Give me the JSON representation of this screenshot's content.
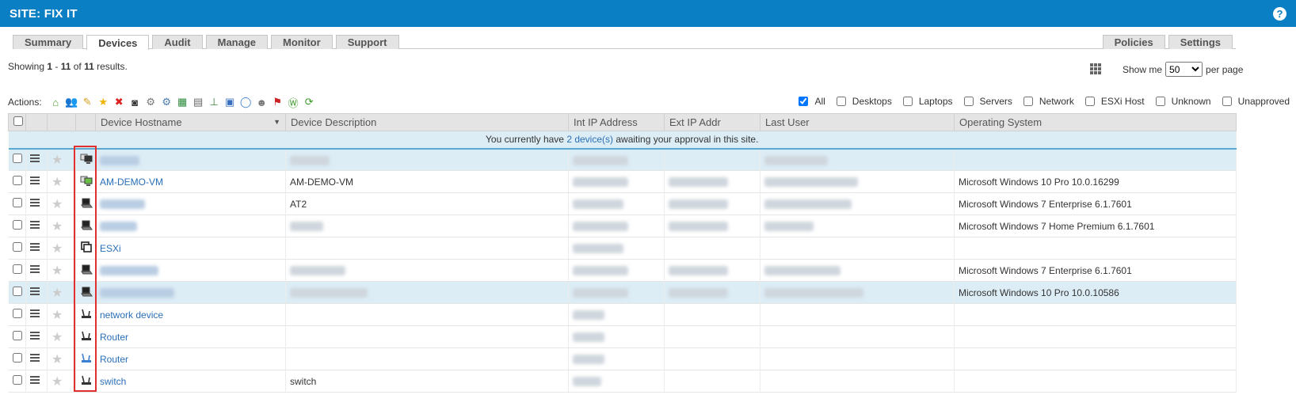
{
  "header": {
    "title": "SITE: FIX IT",
    "help_icon": "?"
  },
  "tabs": [
    {
      "label": "Summary",
      "active": false
    },
    {
      "label": "Devices",
      "active": true
    },
    {
      "label": "Audit",
      "active": false
    },
    {
      "label": "Manage",
      "active": false
    },
    {
      "label": "Monitor",
      "active": false
    },
    {
      "label": "Support",
      "active": false
    }
  ],
  "tabs_right": [
    {
      "label": "Policies"
    },
    {
      "label": "Settings"
    }
  ],
  "results": {
    "prefix": "Showing ",
    "from": "1",
    "dash": " - ",
    "to": "11",
    "of": " of ",
    "total": "11",
    "suffix": " results."
  },
  "show_me": {
    "label": "Show me",
    "value": "50",
    "suffix": "per page"
  },
  "actions_label": "Actions:",
  "action_icons": [
    "house-icon",
    "users-icon",
    "pencil-icon",
    "star-icon",
    "delete-icon",
    "binoculars-icon",
    "gear-icon",
    "gears-icon",
    "excel-icon",
    "server-icon",
    "network-icon",
    "monitor-icon",
    "chat-icon",
    "user-remove-icon",
    "flag-icon",
    "w-icon",
    "refresh-icon"
  ],
  "filters": [
    {
      "label": "All",
      "checked": true
    },
    {
      "label": "Desktops",
      "checked": false
    },
    {
      "label": "Laptops",
      "checked": false
    },
    {
      "label": "Servers",
      "checked": false
    },
    {
      "label": "Network",
      "checked": false
    },
    {
      "label": "ESXi Host",
      "checked": false
    },
    {
      "label": "Unknown",
      "checked": false
    },
    {
      "label": "Unapproved",
      "checked": false
    }
  ],
  "columns": [
    "Device Hostname",
    "Device Description",
    "Int IP Address",
    "Ext IP Addr",
    "Last User",
    "Operating System"
  ],
  "notice": {
    "prefix": "You currently have ",
    "link": "2 device(s)",
    "suffix": " awaiting your approval in this site."
  },
  "rows": [
    {
      "icon": "desktop-unapproved",
      "hostname": "",
      "description": "",
      "os": "",
      "selected": true,
      "blur": [
        true,
        true,
        true,
        false,
        true
      ]
    },
    {
      "icon": "desktop-green",
      "hostname": "AM-DEMO-VM",
      "description": "AM-DEMO-VM",
      "os": "Microsoft Windows 10 Pro 10.0.16299",
      "selected": false,
      "blur": [
        false,
        false,
        true,
        true,
        true
      ]
    },
    {
      "icon": "laptop",
      "hostname": "",
      "description": "AT2",
      "os": "Microsoft Windows 7 Enterprise 6.1.7601",
      "selected": false,
      "blur": [
        true,
        false,
        true,
        true,
        true
      ]
    },
    {
      "icon": "laptop",
      "hostname": "",
      "description": "",
      "os": "Microsoft Windows 7 Home Premium 6.1.7601",
      "selected": false,
      "blur": [
        true,
        true,
        true,
        true,
        true
      ]
    },
    {
      "icon": "esxi",
      "hostname": "ESXi",
      "description": "",
      "os": "",
      "selected": false,
      "blur": [
        false,
        false,
        true,
        false,
        false
      ]
    },
    {
      "icon": "laptop",
      "hostname": "",
      "description": "",
      "os": "Microsoft Windows 7 Enterprise 6.1.7601",
      "selected": false,
      "blur": [
        true,
        true,
        true,
        true,
        true
      ]
    },
    {
      "icon": "laptop",
      "hostname": "",
      "description": "",
      "os": "Microsoft Windows 10 Pro 10.0.10586",
      "selected": true,
      "blur": [
        true,
        true,
        true,
        true,
        true
      ]
    },
    {
      "icon": "network",
      "hostname": "network device",
      "description": "",
      "os": "",
      "selected": false,
      "blur": [
        false,
        false,
        true,
        false,
        false
      ]
    },
    {
      "icon": "network",
      "hostname": "Router",
      "description": "",
      "os": "",
      "selected": false,
      "blur": [
        false,
        false,
        true,
        false,
        false
      ]
    },
    {
      "icon": "network-blue",
      "hostname": "Router",
      "description": "",
      "os": "",
      "selected": false,
      "blur": [
        false,
        false,
        true,
        false,
        false
      ]
    },
    {
      "icon": "network",
      "hostname": "switch",
      "description": "switch",
      "os": "",
      "selected": false,
      "blur": [
        false,
        false,
        true,
        false,
        false
      ]
    }
  ]
}
